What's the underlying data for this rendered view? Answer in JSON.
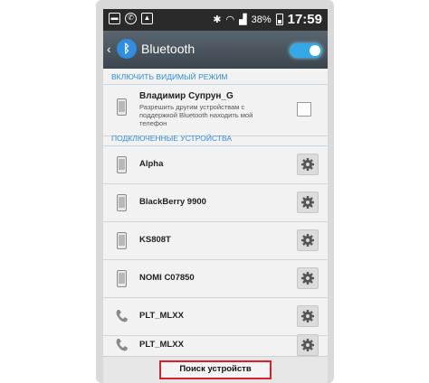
{
  "status_bar": {
    "battery": "38%",
    "time": "17:59"
  },
  "action_bar": {
    "title": "Bluetooth",
    "toggle_on": true
  },
  "visible_section": {
    "header": "ВКЛЮЧИТЬ ВИДИМЫЙ РЕЖИМ",
    "device_name": "Владимир Супрун_G",
    "description": "Разрешить другим устройствам с поддержкой Bluetooth находить мой телефон",
    "checked": false
  },
  "connected_section": {
    "header": "ПОДКЛЮЧЕННЫЕ УСТРОЙСТВА",
    "devices": [
      {
        "name": "Alpha",
        "icon": "phone-icon"
      },
      {
        "name": "BlackBerry 9900",
        "icon": "phone-icon"
      },
      {
        "name": "KS808T",
        "icon": "phone-icon"
      },
      {
        "name": "NOMI C07850",
        "icon": "phone-icon"
      },
      {
        "name": "PLT_MLXX",
        "icon": "handset-icon"
      },
      {
        "name": "PLT_MLXX",
        "icon": "handset-icon"
      }
    ]
  },
  "bottom": {
    "search_label": "Поиск устройств"
  },
  "colors": {
    "accent": "#2f8ed8",
    "highlight": "#d4242a"
  }
}
